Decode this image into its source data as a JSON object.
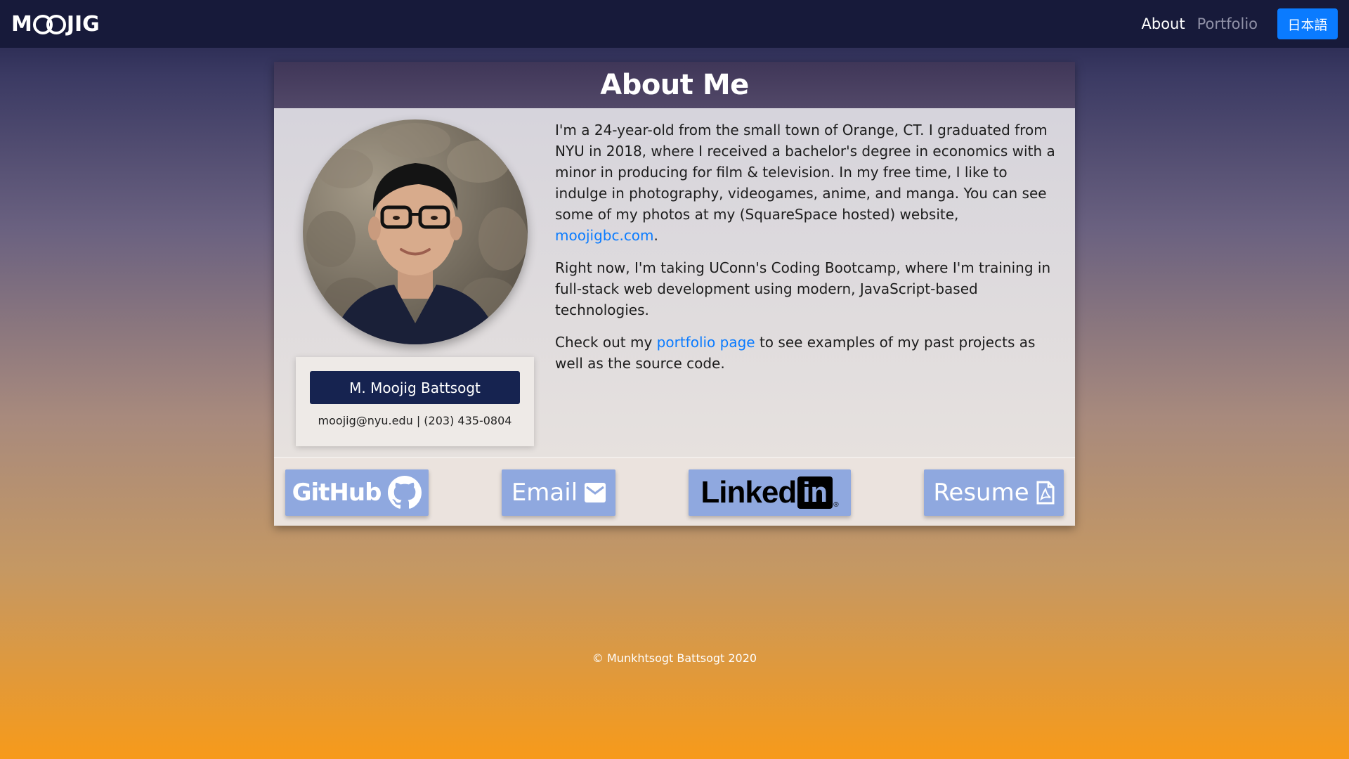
{
  "navbar": {
    "logo": "MOOJIG",
    "links": [
      {
        "label": "About",
        "active": true
      },
      {
        "label": "Portfolio",
        "active": false
      }
    ],
    "language_button": "日本語"
  },
  "card": {
    "title": "About Me",
    "profile": {
      "name": "M. Moojig Battsogt",
      "contact": "moojig@nyu.edu | (203) 435-0804"
    },
    "bio": {
      "p1_text": "I'm a 24-year-old from the small town of Orange, CT. I graduated from NYU in 2018, where I received a bachelor's degree in economics with a minor in producing for film & television. In my free time, I like to indulge in photography, videogames, anime, and manga. You can see some of my photos at my (SquareSpace hosted) website,",
      "p1_link": "moojigbc.com",
      "p1_end": ".",
      "p2_text": "Right now, I'm taking UConn's Coding Bootcamp, where I'm training in full-stack web development using modern, JavaScript-based technologies.",
      "p3_before": "Check out my",
      "p3_link": "portfolio page",
      "p3_after": "to see examples of my past projects as well as the source code."
    },
    "social": {
      "github": "GitHub",
      "email": "Email",
      "linkedin": "Linked",
      "linkedin_box": "in",
      "linkedin_reg": "®",
      "resume": "Resume"
    }
  },
  "footer": "© Munkhtsogt Battsogt 2020",
  "colors": {
    "navbar_bg": "#171a3a",
    "accent_blue": "#0a7bff",
    "name_button": "#162350",
    "social_button": "#8fa8df"
  }
}
